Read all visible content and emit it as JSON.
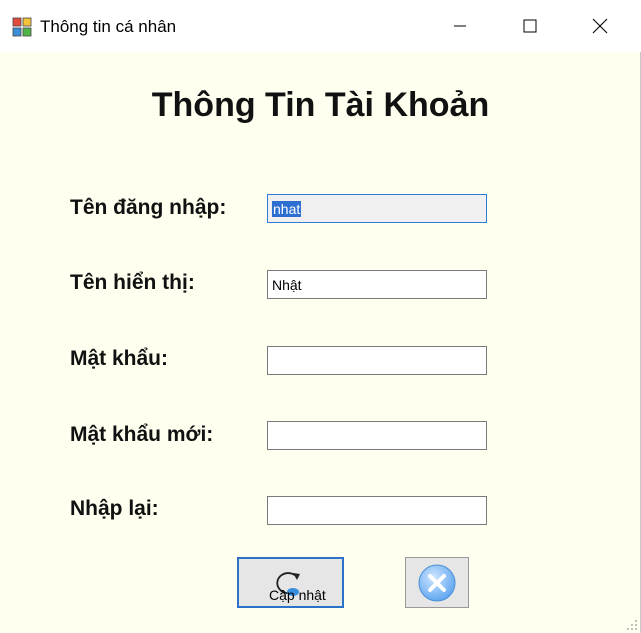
{
  "window": {
    "title": "Thông tin cá nhân"
  },
  "form": {
    "heading": "Thông Tin Tài Khoản",
    "username_label": "Tên đăng nhập:",
    "username_value": "nhat",
    "display_name_label": "Tên hiển thị:",
    "display_name_value": "Nhật",
    "password_label": "Mật khẩu:",
    "password_value": "",
    "new_password_label": "Mật khẩu mới:",
    "new_password_value": "",
    "confirm_label": "Nhập lại:",
    "confirm_value": ""
  },
  "buttons": {
    "update_label": "Cập nhật",
    "update_icon": "refresh-icon",
    "cancel_icon": "close-circle-icon"
  },
  "colors": {
    "form_background": "#fffff0",
    "focus_border": "#2a73c8",
    "selection": "#2d6fd1"
  }
}
